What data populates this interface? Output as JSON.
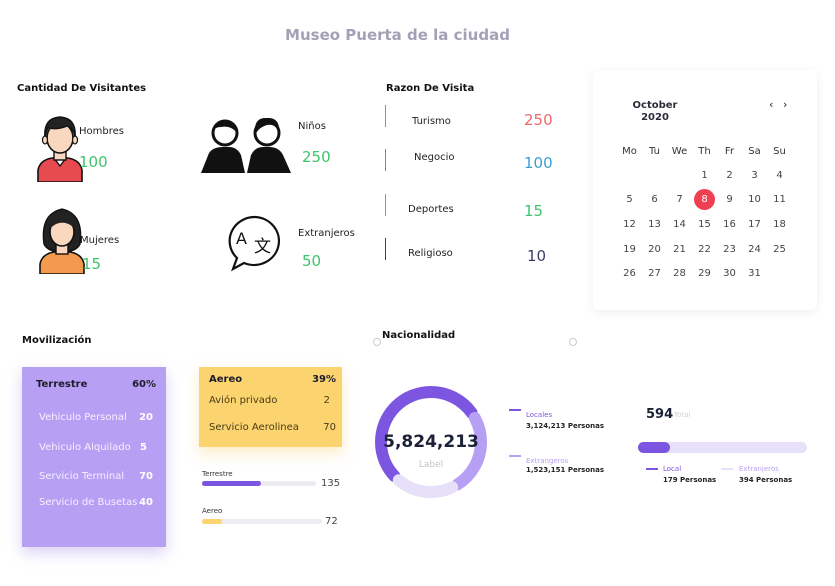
{
  "title": "Museo Puerta de la ciudad",
  "visitors": {
    "title": "Cantidad De Visitantes",
    "items": [
      {
        "label": "Hombres",
        "value": "100",
        "icon": "man-avatar-icon"
      },
      {
        "label": "Niños",
        "value": "250",
        "icon": "children-icon"
      },
      {
        "label": "Mujeres",
        "value": "15",
        "icon": "woman-avatar-icon"
      },
      {
        "label": "Extranjeros",
        "value": "50",
        "icon": "translate-icon"
      }
    ]
  },
  "reasons": {
    "title": "Razon De Visita",
    "items": [
      {
        "label": "Turismo",
        "value": "250",
        "color": "#f0696d"
      },
      {
        "label": "Negocio",
        "value": "100",
        "color": "#3b9fd1"
      },
      {
        "label": "Deportes",
        "value": "15",
        "color": "#3ec46d"
      },
      {
        "label": "Religioso",
        "value": "10",
        "color": "#3c3c66"
      }
    ]
  },
  "calendar": {
    "month": "October",
    "year": "2020",
    "prev": "‹",
    "next": "›",
    "weekdays": [
      "Mo",
      "Tu",
      "We",
      "Th",
      "Fr",
      "Sa",
      "Su"
    ],
    "days": [
      "",
      "",
      "",
      "1",
      "2",
      "3",
      "4",
      "5",
      "6",
      "7",
      "8",
      "9",
      "10",
      "11",
      "12",
      "13",
      "14",
      "15",
      "16",
      "17",
      "18",
      "19",
      "20",
      "21",
      "22",
      "23",
      "24",
      "25",
      "26",
      "27",
      "28",
      "29",
      "30",
      "31",
      ""
    ],
    "selected": "8",
    "accent": "#ef3f52"
  },
  "mobility": {
    "title": "Movilización",
    "terrestre": {
      "title": "Terrestre",
      "percent": "60%",
      "items": [
        {
          "label": "Vehiculo Personal",
          "value": "20"
        },
        {
          "label": "Vehiculo Alquilado",
          "value": "5"
        },
        {
          "label": "Servicio Terminal",
          "value": "70"
        },
        {
          "label": "Servicio de Busetas",
          "value": "40"
        }
      ]
    },
    "aereo": {
      "title": "Aereo",
      "percent": "39%",
      "items": [
        {
          "label": "Avión privado",
          "value": "2"
        },
        {
          "label": "Servicio Aerolinea",
          "value": "70"
        }
      ]
    },
    "bars": [
      {
        "label": "Terrestre",
        "value": "135",
        "fill": 0.52,
        "color": "#7c56e0"
      },
      {
        "label": "Aereo",
        "value": "72",
        "fill": 0.17,
        "color": "#fbd46f"
      }
    ]
  },
  "nationality": {
    "title": "Nacionalidad",
    "total": "5,824,213",
    "total_label": "Label",
    "donut": [
      {
        "name": "Locales",
        "fraction": 0.54,
        "color": "#7c56e0"
      },
      {
        "name": "Extrangeros",
        "fraction": 0.26,
        "color": "#b7a0f4"
      },
      {
        "name": "rest",
        "fraction": 0.2,
        "color": "#e6e0f8"
      }
    ],
    "legend": [
      {
        "label": "Locales",
        "value": "3,124,213 Personas",
        "color": "#7c56e0"
      },
      {
        "label": "Extrangeros",
        "value": "1,523,151 Personas",
        "color": "#b7a0f4"
      }
    ],
    "summary": {
      "value": "594",
      "value_label": "Total",
      "fill": 0.19,
      "legend": [
        {
          "label": "Local",
          "value": "179 Personas",
          "color": "#7c56e0"
        },
        {
          "label": "Extranjeros",
          "value": "394 Personas",
          "color": "#e6e0f8"
        }
      ]
    }
  }
}
